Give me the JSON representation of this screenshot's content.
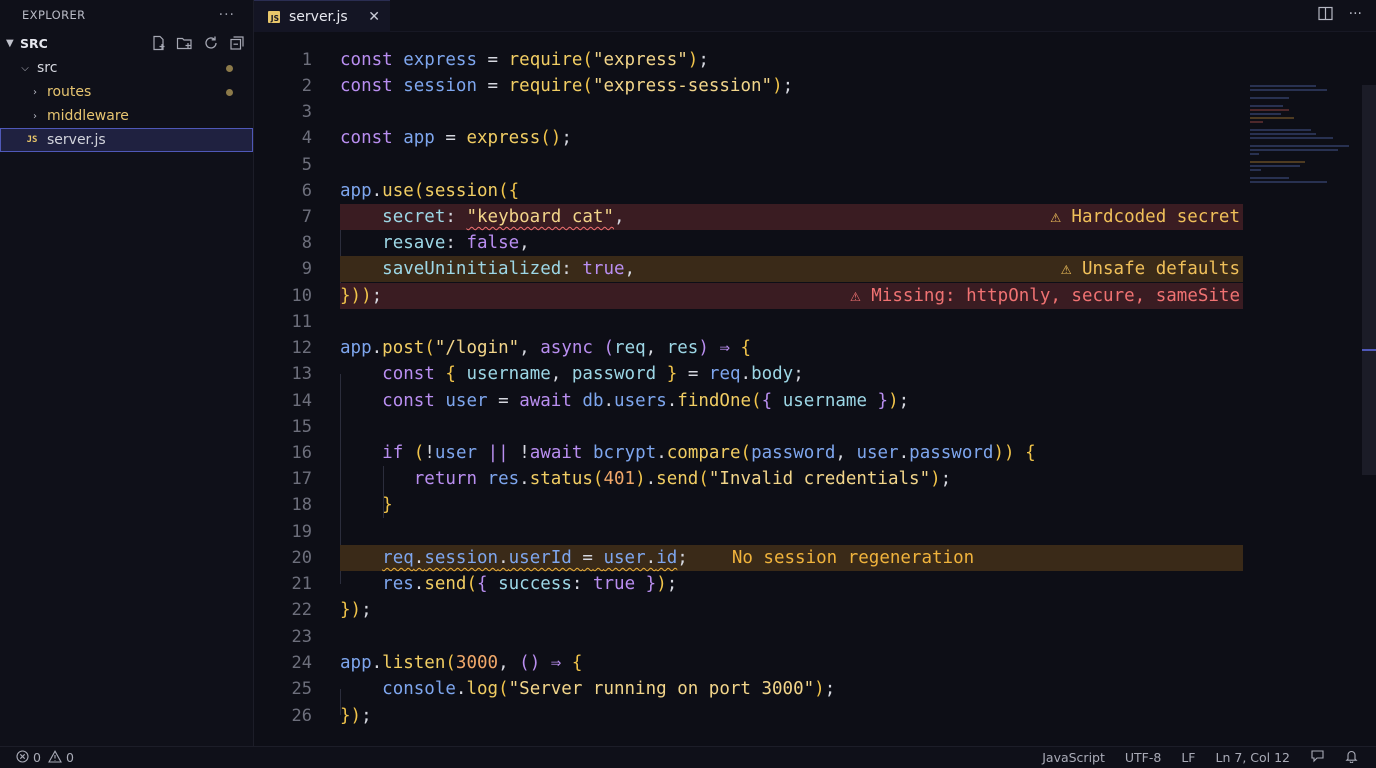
{
  "explorer": {
    "title": "EXPLORER",
    "more": "···",
    "root": "SRC",
    "items": [
      {
        "label": "src",
        "type": "folder",
        "expanded": true
      },
      {
        "label": "routes",
        "type": "folder",
        "expanded": false
      },
      {
        "label": "middleware",
        "type": "folder",
        "expanded": false
      },
      {
        "label": "server.js",
        "type": "file",
        "badge": "JS"
      }
    ]
  },
  "tab": {
    "label": "server.js",
    "icon": "JS",
    "close": "✕"
  },
  "code": {
    "annotations": {
      "l7": "⚠ Hardcoded secret",
      "l9": "⚠ Unsafe defaults",
      "l10": "⚠ Missing: httpOnly, secure, sameSite",
      "l20": "No session regeneration"
    }
  },
  "status": {
    "errors": "0",
    "warnings": "0",
    "language": "JavaScript",
    "encoding": "UTF-8",
    "eol": "LF",
    "cursor": "Ln 7, Col 12"
  },
  "colors": {
    "accent": "#4f58b8",
    "warning": "#f0c05a",
    "error": "#f07272"
  }
}
